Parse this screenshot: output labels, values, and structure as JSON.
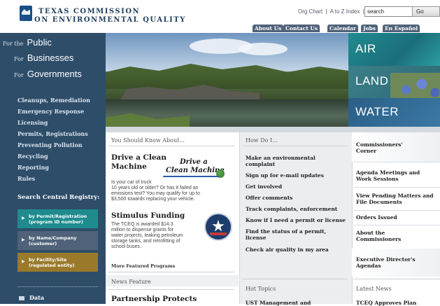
{
  "header": {
    "logo_line1": "TEXAS COMMISSION",
    "logo_line2": "ON ENVIRONMENTAL QUALITY",
    "util_links": [
      "Org Chart",
      "|",
      "A to Z Index",
      "|"
    ],
    "search": {
      "value": "search",
      "button_label": "Go"
    }
  },
  "topnav": [
    "About Us",
    "Contact Us",
    "Calendar",
    "Jobs",
    "En Español"
  ],
  "audience": [
    {
      "prefix": "For the",
      "label": "Public"
    },
    {
      "prefix": "For",
      "label": "Businesses"
    },
    {
      "prefix": "For",
      "label": "Governments"
    }
  ],
  "sidebar_links": [
    "Cleanups, Remediation",
    "Emergency Response",
    "Licensing",
    "Permits, Registrations",
    "Preventing Pollution",
    "Recycling",
    "Reporting",
    "Rules"
  ],
  "search_registry": {
    "title": "Search Central Registry:",
    "items": [
      {
        "line1": "by Permit/Registration",
        "line2": "(program ID number)",
        "color": "#1f8b8f"
      },
      {
        "line1": "by Name/Company",
        "line2": "(customer)",
        "color": "#4f6279"
      },
      {
        "line1": "by Facility/Site",
        "line2": "(regulated entity)",
        "color": "#9a7a2a"
      }
    ]
  },
  "sidebar_data_label": "Data",
  "tiles": {
    "air": "AIR",
    "land": "LAND",
    "water": "WATER"
  },
  "featured": {
    "heading": "You Should Know About...",
    "drive_title": "Drive a Clean Machine",
    "drive_title_l1": "Drive a Clean",
    "drive_title_l2": "Machine",
    "drive_logo_l1": "Drive a",
    "drive_logo_l2": "Clean Machine",
    "drive_body": [
      "Is your car of truck",
      "10 years old or older? Or has it failed an",
      "emissions test? You may qualify for up to",
      "$3,500 towards replacing your vehicle."
    ],
    "stim_title": "Stimulus Funding",
    "stim_body": [
      "The TCEQ is awarded $14.3",
      "million to dispense grants for",
      "water projects, leaking petroleum",
      "storage tanks, and retrofitting of",
      "school buses."
    ],
    "more_link": "More Featured Programs",
    "news_heading": "News Feature",
    "news_title": "Partnership Protects"
  },
  "howdo": {
    "heading": "How Do I...",
    "items": [
      [
        "Make an environmental",
        "complaint"
      ],
      [
        "Sign up for e-mail updates"
      ],
      [
        "Get involved"
      ],
      [
        "Offer comments"
      ],
      [
        "Track complaints, enforcement"
      ],
      [
        "Know if I need a permit or license"
      ],
      [
        "Find the status of a permit,",
        "license"
      ],
      [
        "Check air quality in my area"
      ]
    ],
    "hot_topics": "Hot Topics",
    "hot_topic_item": "UST Management and"
  },
  "commissioners": {
    "items": [
      [
        "Commissioners'",
        "Corner"
      ],
      [
        "Agenda Meetings and",
        "Work Sessions"
      ],
      [
        "View Pending Matters and",
        "File Documents"
      ],
      [
        "Orders Issued"
      ],
      [
        "About the",
        "Commissioners"
      ],
      [
        "Executive Director's",
        "Agendas"
      ]
    ],
    "latest_news": "Latest News",
    "latest_news_item": "TCEQ Approves Plan"
  }
}
